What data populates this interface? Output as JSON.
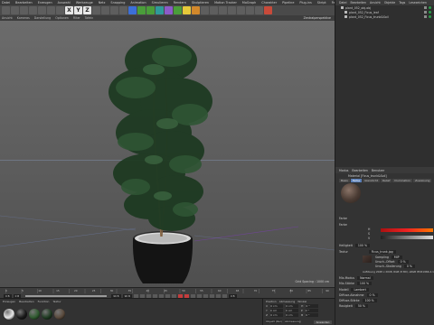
{
  "menubar": {
    "items": [
      "Datei",
      "Bearbeiten",
      "Erzeugen",
      "Auswahl",
      "Werkzeuge",
      "Netz",
      "Snapping",
      "Animation",
      "Simulieren",
      "Rendern",
      "Skulptieren",
      "Motion Tracker",
      "MoGraph",
      "Charakter",
      "Pipeline",
      "Plug-ins",
      "Skript",
      "Fenster",
      "Hilfe"
    ]
  },
  "toolbar": {
    "axes": [
      "X",
      "Y",
      "Z"
    ]
  },
  "viewport": {
    "menu": [
      "Ansicht",
      "Kameras",
      "Darstellung",
      "Optionen",
      "Filter",
      "Tafeln"
    ],
    "camera_label": "Zentralperspektive",
    "grid_label": "Grid Spacing : 1000 cm"
  },
  "object_manager": {
    "menu": [
      "Datei",
      "Bearbeiten",
      "Ansicht",
      "Objekte",
      "Tags",
      "Lesezeichen"
    ],
    "objects": [
      {
        "name": "plant_052_obj.obj"
      },
      {
        "name": "plant_052_Ficus_leaf"
      },
      {
        "name": "plant_052_Ficus_trunk&Soil"
      }
    ]
  },
  "attribute_manager": {
    "menu": [
      "Modus",
      "Bearbeiten",
      "Benutzer"
    ],
    "material_name": "Material [Ficus_trunk&Soil]",
    "tabs": [
      "Basis",
      "Farbe",
      "Glanzlicht",
      "Relief",
      "Illumination",
      "Zuweisung"
    ],
    "color_section": "Farbe",
    "color_label": "Farbe",
    "h_label": "H",
    "s_label": "S",
    "v_label": "V",
    "brightness_label": "Helligkeit",
    "brightness_value": "100 %",
    "texture_label": "Textur",
    "texture_file": "Ficus_trunk.jpg",
    "sampling_label": "Sampling",
    "sampling_value": "MIP",
    "blur_offset_label": "Unsch.-Offset",
    "blur_offset_value": "0 %",
    "blur_scale_label": "Unsch.-Skalierung",
    "blur_scale_value": "0 %",
    "resolution": "Auflösung 2048 x 2048, RGB (8 Bit), sRGB IEC61966-2.1",
    "mix_mode_label": "Mix-Modus",
    "mix_mode_value": "Normal",
    "mix_strength_label": "Mix-Stärke",
    "mix_strength_value": "100 %",
    "model_label": "Modell",
    "model_value": "Lambert",
    "diffuse_falloff_label": "Diffuse-Abnahme",
    "diffuse_falloff_value": "0 %",
    "diffuse_level_label": "Diffuse-Stärke",
    "diffuse_level_value": "100 %",
    "roughness_label": "Rauigkeit",
    "roughness_value": "50 %"
  },
  "timeline": {
    "ticks": [
      "0",
      "5",
      "10",
      "15",
      "20",
      "25",
      "30",
      "35",
      "40",
      "45",
      "50",
      "55",
      "60",
      "65",
      "70",
      "75",
      "80",
      "85",
      "90"
    ],
    "start_frame": "0 B",
    "current_frame": "0 B",
    "end_frame": "90 B",
    "end_frame2": "90 B",
    "frame_readout": "0 B"
  },
  "material_manager": {
    "menu": [
      "Erzeugen",
      "Bearbeiten",
      "Funktion",
      "Textur"
    ],
    "materials": [
      {
        "color": "#e8e8e8"
      },
      {
        "color": "#1a1a1a"
      },
      {
        "color": "#2f5a2f"
      },
      {
        "color": "#1f3b22"
      },
      {
        "color": "#5a4a3c"
      }
    ]
  },
  "coordinates": {
    "headers": [
      "Position",
      "Abmessung",
      "Winkel"
    ],
    "rows": [
      {
        "axis": "X",
        "pos": "0 cm",
        "size": "0 cm",
        "rot_label": "H",
        "rot": "0 °"
      },
      {
        "axis": "Y",
        "pos": "0 cm",
        "size": "0 cm",
        "rot_label": "P",
        "rot": "0 °"
      },
      {
        "axis": "Z",
        "pos": "0 cm",
        "size": "0 cm",
        "rot_label": "B",
        "rot": "0 °"
      }
    ],
    "mode_left": "Objekt (Rel)",
    "mode_right": "Abmessung",
    "apply_label": "Anwenden"
  }
}
